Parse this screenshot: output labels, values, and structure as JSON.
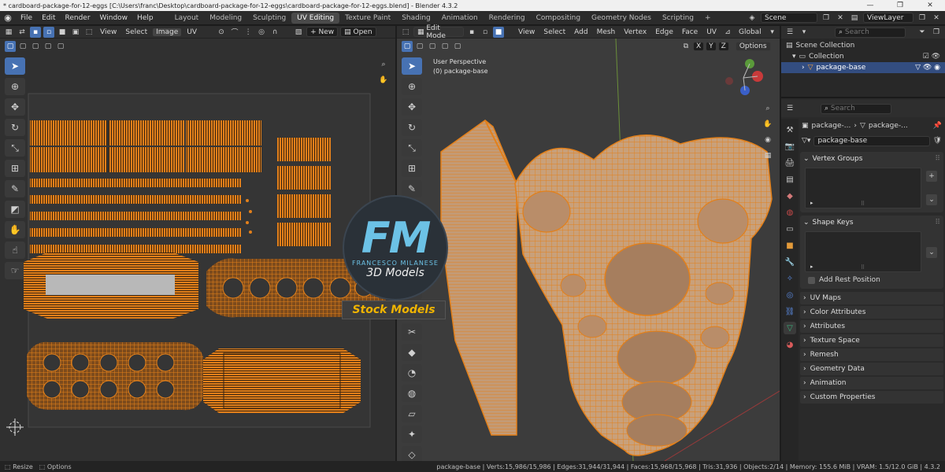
{
  "window": {
    "title": "* cardboard-package-for-12-eggs [C:\\Users\\franc\\Desktop\\cardboard-package-for-12-eggs\\cardboard-package-for-12-eggs.blend] - Blender 4.3.2",
    "minimize": "—",
    "maximize": "❐",
    "close": "✕"
  },
  "topbar": {
    "menus": [
      "File",
      "Edit",
      "Render",
      "Window",
      "Help"
    ],
    "workspaces": [
      "Layout",
      "Modeling",
      "Sculpting",
      "UV Editing",
      "Texture Paint",
      "Shading",
      "Animation",
      "Rendering",
      "Compositing",
      "Geometry Nodes",
      "Scripting"
    ],
    "active_workspace": "UV Editing",
    "add_tab": "+",
    "scene": "Scene",
    "view_layer": "ViewLayer"
  },
  "uv_editor": {
    "menus": [
      "View",
      "Select",
      "Image",
      "UV"
    ],
    "new_label": "New",
    "open_label": "Open"
  },
  "viewport": {
    "mode": "Edit Mode",
    "menus": [
      "View",
      "Select",
      "Add",
      "Mesh",
      "Vertex",
      "Edge",
      "Face",
      "UV"
    ],
    "transform_orientation": "Global",
    "axes": [
      "X",
      "Y",
      "Z"
    ],
    "options_label": "Options",
    "perspective_label": "User Perspective",
    "object_label": "(0) package-base"
  },
  "outliner": {
    "search_placeholder": "Search",
    "scene_collection": "Scene Collection",
    "collection": "Collection",
    "object": "package-base"
  },
  "properties": {
    "search_placeholder": "Search",
    "breadcrumb": [
      "package-...",
      "package-..."
    ],
    "mesh_name": "package-base",
    "vertex_groups": "Vertex Groups",
    "shape_keys": "Shape Keys",
    "add_rest_position": "Add Rest Position",
    "collapsed_panels": [
      "UV Maps",
      "Color Attributes",
      "Attributes",
      "Texture Space",
      "Remesh",
      "Geometry Data",
      "Animation",
      "Custom Properties"
    ]
  },
  "watermark": {
    "initials": "FM",
    "name": "FRANCESCO MILANESE",
    "tagline": "3D Models",
    "badge": "Stock Models"
  },
  "statusbar": {
    "left": [
      "Resize",
      "Options"
    ],
    "stats": "package-base | Verts:15,986/15,986 | Edges:31,944/31,944 | Faces:15,968/15,968 | Tris:31,936 | Objects:2/14 | Memory: 155.6 MiB | VRAM: 1.5/12.0 GiB | 4.3.2"
  },
  "colors": {
    "accent": "#4772b3",
    "mesh_orange": "#e3801a",
    "mesh_face": "#c9a07a"
  }
}
